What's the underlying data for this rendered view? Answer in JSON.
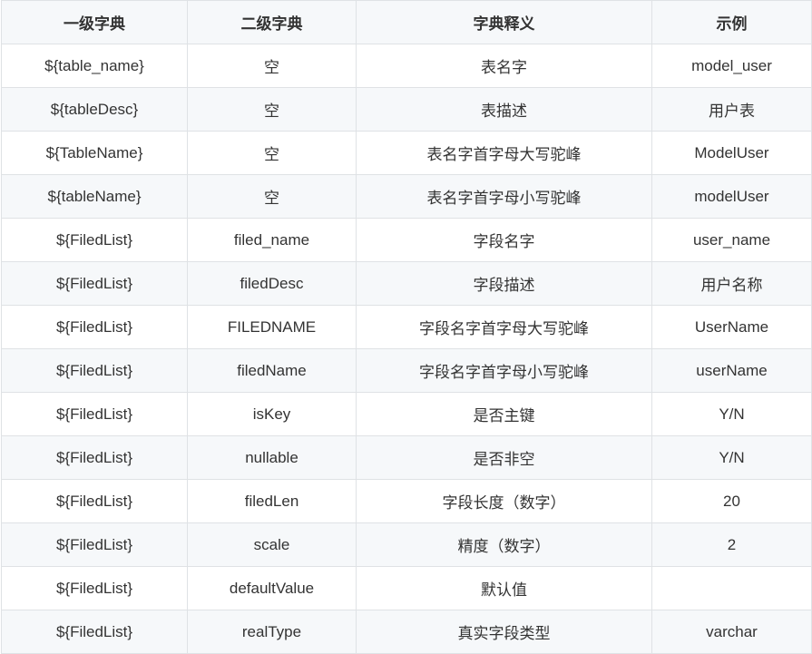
{
  "table": {
    "headers": [
      "一级字典",
      "二级字典",
      "字典释义",
      "示例"
    ],
    "rows": [
      [
        "${table_name}",
        "空",
        "表名字",
        "model_user"
      ],
      [
        "${tableDesc}",
        "空",
        "表描述",
        "用户表"
      ],
      [
        "${TableName}",
        "空",
        "表名字首字母大写驼峰",
        "ModelUser"
      ],
      [
        "${tableName}",
        "空",
        "表名字首字母小写驼峰",
        "modelUser"
      ],
      [
        "${FiledList}",
        "filed_name",
        "字段名字",
        "user_name"
      ],
      [
        "${FiledList}",
        "filedDesc",
        "字段描述",
        "用户名称"
      ],
      [
        "${FiledList}",
        "FILEDNAME",
        "字段名字首字母大写驼峰",
        "UserName"
      ],
      [
        "${FiledList}",
        "filedName",
        "字段名字首字母小写驼峰",
        "userName"
      ],
      [
        "${FiledList}",
        "isKey",
        "是否主键",
        "Y/N"
      ],
      [
        "${FiledList}",
        "nullable",
        "是否非空",
        "Y/N"
      ],
      [
        "${FiledList}",
        "filedLen",
        "字段长度（数字）",
        "20"
      ],
      [
        "${FiledList}",
        "scale",
        "精度（数字）",
        "2"
      ],
      [
        "${FiledList}",
        "defaultValue",
        "默认值",
        ""
      ],
      [
        "${FiledList}",
        "realType",
        "真实字段类型",
        "varchar"
      ]
    ]
  }
}
